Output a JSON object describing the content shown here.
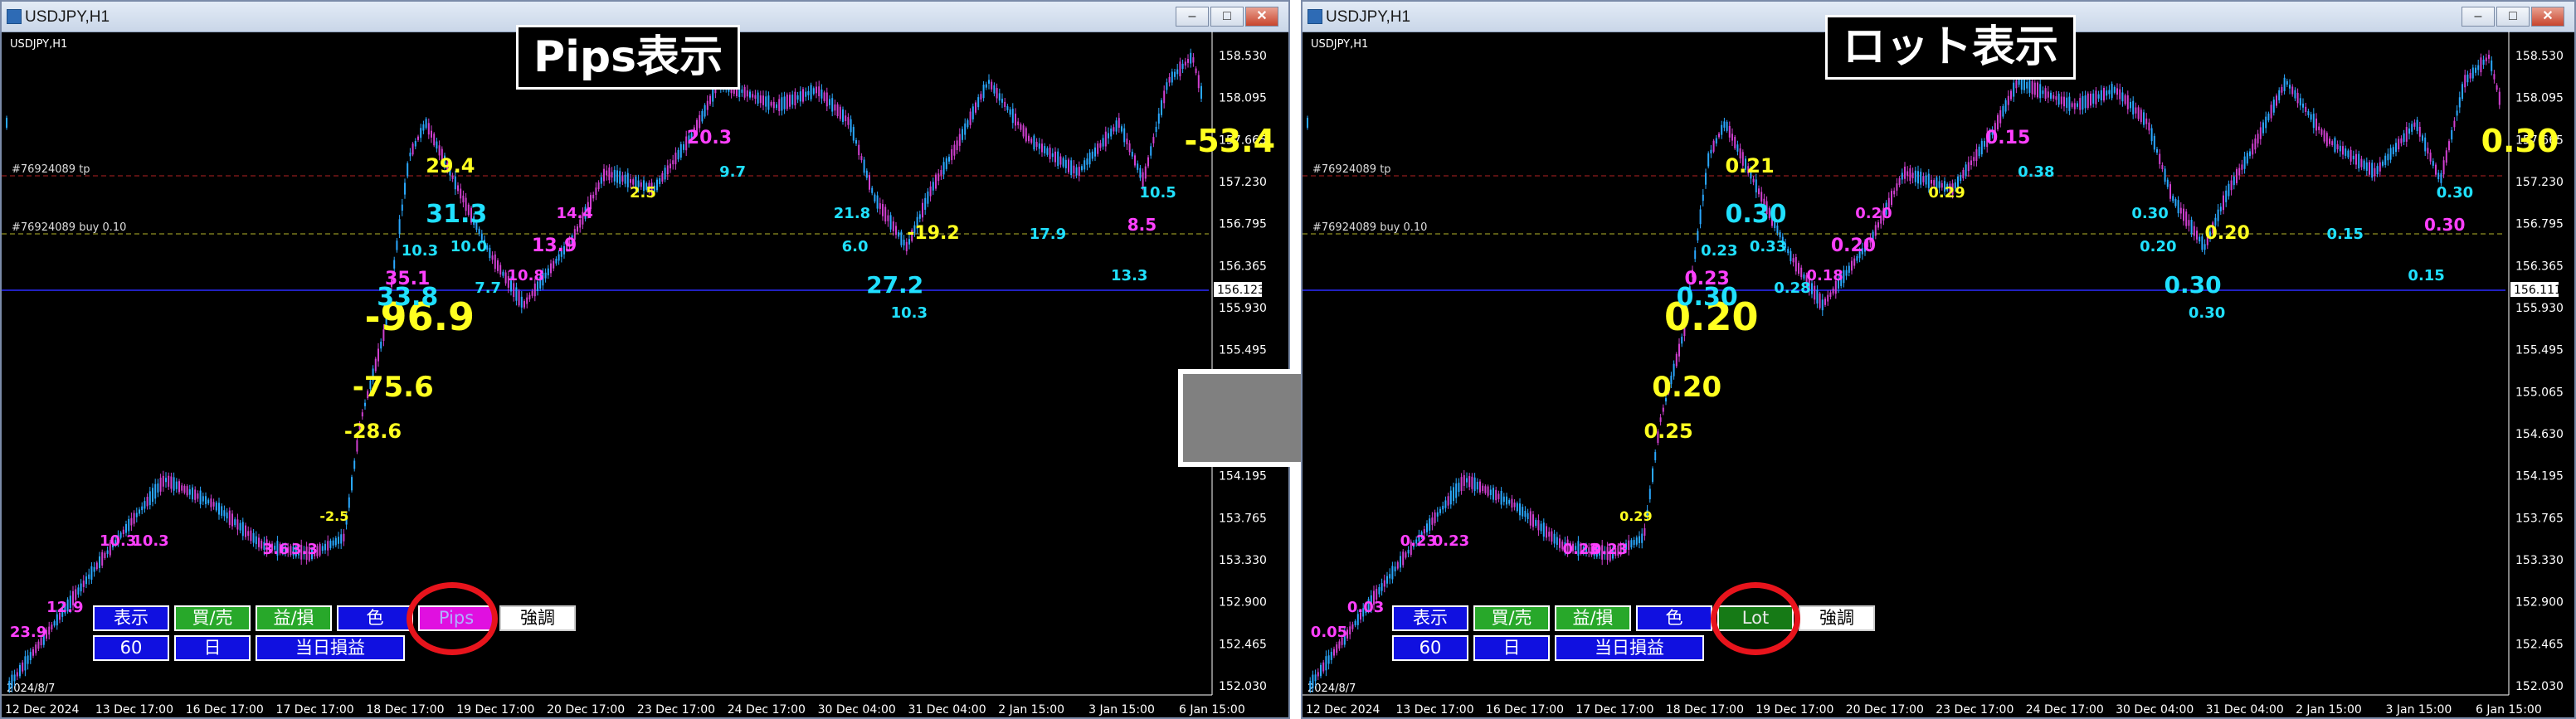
{
  "arrow_color": "#808080",
  "left": {
    "window_title": "USDJPY,H1",
    "symbol_label": "USDJPY,H1",
    "banner": "Pips表示",
    "level_tp": "#76924089 tp",
    "level_buy": "#76924089 buy 0.10",
    "current_price": "156.123",
    "date_corner": "2024/8/7",
    "price_ticks": [
      "158.530",
      "158.095",
      "157.665",
      "157.230",
      "156.795",
      "156.365",
      "155.930",
      "155.495",
      "155.065",
      "154.630",
      "154.195",
      "153.765",
      "153.330",
      "152.900",
      "152.465",
      "152.030"
    ],
    "time_ticks": [
      "12 Dec 2024",
      "13 Dec 17:00",
      "16 Dec 17:00",
      "17 Dec 17:00",
      "18 Dec 17:00",
      "19 Dec 17:00",
      "20 Dec 17:00",
      "23 Dec 17:00",
      "24 Dec 17:00",
      "30 Dec 04:00",
      "31 Dec 04:00",
      "2 Jan 15:00",
      "3 Jan 15:00",
      "6 Jan 15:00"
    ],
    "labels": [
      "23.9",
      "12.9",
      "10.3",
      "10.3",
      "3.6",
      "3.3",
      "-2.5",
      "-28.6",
      "-75.6",
      "-96.9",
      "33.8",
      "35.1",
      "10.3",
      "29.4",
      "31.3",
      "10.0",
      "7.7",
      "10.8",
      "13.9",
      "14.4",
      "2.5",
      "20.3",
      "9.7",
      "21.8",
      "6.0",
      "-19.2",
      "27.2",
      "10.3",
      "17.9",
      "13.3",
      "8.5",
      "10.5",
      "-53.4"
    ],
    "buttons": {
      "show": "表示",
      "buysell": "買/売",
      "profit": "益/損",
      "color": "色",
      "mode": "Pips",
      "emphasis": "強調",
      "period": "60",
      "day": "日",
      "daily_pl": "当日損益"
    }
  },
  "right": {
    "window_title": "USDJPY,H1",
    "symbol_label": "USDJPY,H1",
    "banner": "ロット表示",
    "level_tp": "#76924089 tp",
    "level_buy": "#76924089 buy 0.10",
    "current_price": "156.111",
    "date_corner": "2024/8/7",
    "price_ticks": [
      "158.530",
      "158.095",
      "157.665",
      "157.230",
      "156.795",
      "156.365",
      "155.930",
      "155.495",
      "155.065",
      "154.630",
      "154.195",
      "153.765",
      "153.330",
      "152.900",
      "152.465",
      "152.030"
    ],
    "time_ticks": [
      "12 Dec 2024",
      "13 Dec 17:00",
      "16 Dec 17:00",
      "17 Dec 17:00",
      "18 Dec 17:00",
      "19 Dec 17:00",
      "20 Dec 17:00",
      "23 Dec 17:00",
      "24 Dec 17:00",
      "30 Dec 04:00",
      "31 Dec 04:00",
      "2 Jan 15:00",
      "3 Jan 15:00",
      "6 Jan 15:00"
    ],
    "labels": [
      "0.05",
      "0.03",
      "0.23",
      "0.23",
      "0.23",
      "0.23",
      "0.29",
      "0.25",
      "0.20",
      "0.20",
      "0.30",
      "0.23",
      "0.23",
      "0.21",
      "0.30",
      "0.33",
      "0.28",
      "0.18",
      "0.20",
      "0.20",
      "0.29",
      "0.15",
      "0.38",
      "0.30",
      "0.20",
      "0.20",
      "0.30",
      "0.30",
      "0.15",
      "0.15",
      "0.30",
      "0.30",
      "0.30"
    ],
    "buttons": {
      "show": "表示",
      "buysell": "買/売",
      "profit": "益/損",
      "color": "色",
      "mode": "Lot",
      "emphasis": "強調",
      "period": "60",
      "day": "日",
      "daily_pl": "当日損益"
    }
  }
}
